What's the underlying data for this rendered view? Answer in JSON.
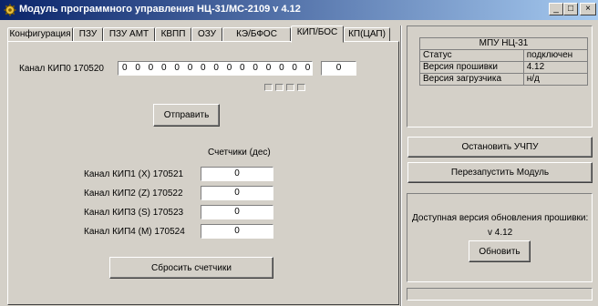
{
  "window": {
    "title": "Модуль программного управления НЦ-31/МС-2109 v 4.12",
    "minimize_glyph": "_",
    "maximize_glyph": "□",
    "close_glyph": "×",
    "app_icon": "gear-icon"
  },
  "tabs": [
    {
      "label": "Конфигурация",
      "active": false
    },
    {
      "label": "ПЗУ",
      "active": false
    },
    {
      "label": "ПЗУ АМТ",
      "active": false
    },
    {
      "label": "КВПП",
      "active": false
    },
    {
      "label": "ОЗУ",
      "active": false
    },
    {
      "label": "КЭ/БФОС",
      "active": false
    },
    {
      "label": "КИП/БОС",
      "active": true
    },
    {
      "label": "КП(ЦАП)",
      "active": false
    }
  ],
  "kip0": {
    "label": "Канал КИП0 170520",
    "bits": "0 0 0 0 0 0 0 0 0 0 0 0 0 0 0 0",
    "value": "0"
  },
  "send_button": "Отправить",
  "counters": {
    "header": "Счетчики (дес)",
    "rows": [
      {
        "label": "Канал КИП1 (X) 170521",
        "value": "0"
      },
      {
        "label": "Канал КИП2 (Z) 170522",
        "value": "0"
      },
      {
        "label": "Канал КИП3 (S) 170523",
        "value": "0"
      },
      {
        "label": "Канал КИП4 (M) 170524",
        "value": "0"
      }
    ],
    "reset_button": "Сбросить счетчики"
  },
  "status_table": {
    "header": "МПУ НЦ-31",
    "rows": [
      {
        "key": "Статус",
        "value": "подключен"
      },
      {
        "key": "Версия прошивки",
        "value": "4.12"
      },
      {
        "key": "Версия загрузчика",
        "value": "н/д"
      }
    ]
  },
  "stop_button": "Остановить УЧПУ",
  "restart_button": "Перезапустить Модуль",
  "update": {
    "text": "Доступная версия обновления прошивки:",
    "version": "v 4.12",
    "button": "Обновить"
  },
  "colors": {
    "face": "#d4d0c8",
    "title_start": "#0a246a",
    "title_end": "#a6caf0"
  }
}
